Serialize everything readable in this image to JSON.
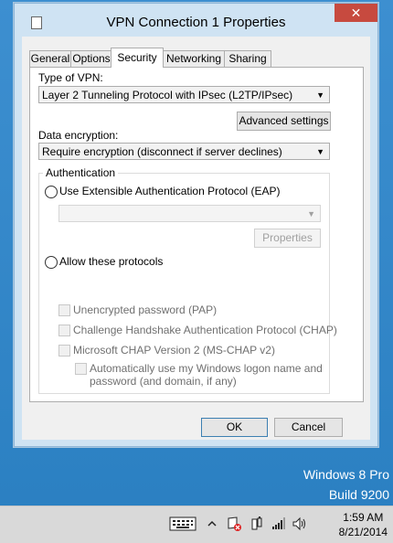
{
  "window": {
    "title": "VPN Connection 1 Properties",
    "close_glyph": "✕"
  },
  "tabs": [
    "General",
    "Options",
    "Security",
    "Networking",
    "Sharing"
  ],
  "active_tab": "Security",
  "security": {
    "vpn_type_label": "Type of VPN:",
    "vpn_type_value": "Layer 2 Tunneling Protocol with IPsec (L2TP/IPsec)",
    "advanced_settings_label": "Advanced settings",
    "encryption_label": "Data encryption:",
    "encryption_value": "Require encryption (disconnect if server declines)",
    "auth_group_label": "Authentication",
    "eap_option_label": "Use Extensible Authentication Protocol (EAP)",
    "eap_select_value": "",
    "properties_label": "Properties",
    "allow_protocols_label": "Allow these protocols",
    "protocols": [
      "Unencrypted password (PAP)",
      "Challenge Handshake Authentication Protocol (CHAP)",
      "Microsoft CHAP Version 2 (MS-CHAP v2)"
    ],
    "auto_logon_line1": "Automatically use my Windows logon name and",
    "auto_logon_line2": "password (and domain, if any)"
  },
  "footer": {
    "ok_label": "OK",
    "cancel_label": "Cancel"
  },
  "desktop": {
    "watermark_line1": "Windows 8 Pro",
    "watermark_line2": "Build 9200"
  },
  "taskbar": {
    "time": "1:59 AM",
    "date": "8/21/2014"
  },
  "colors": {
    "desktop": "#2f86c8",
    "close_button": "#c74a3f",
    "window_frame": "#cfe3f3",
    "taskbar": "#d9d9d9"
  }
}
